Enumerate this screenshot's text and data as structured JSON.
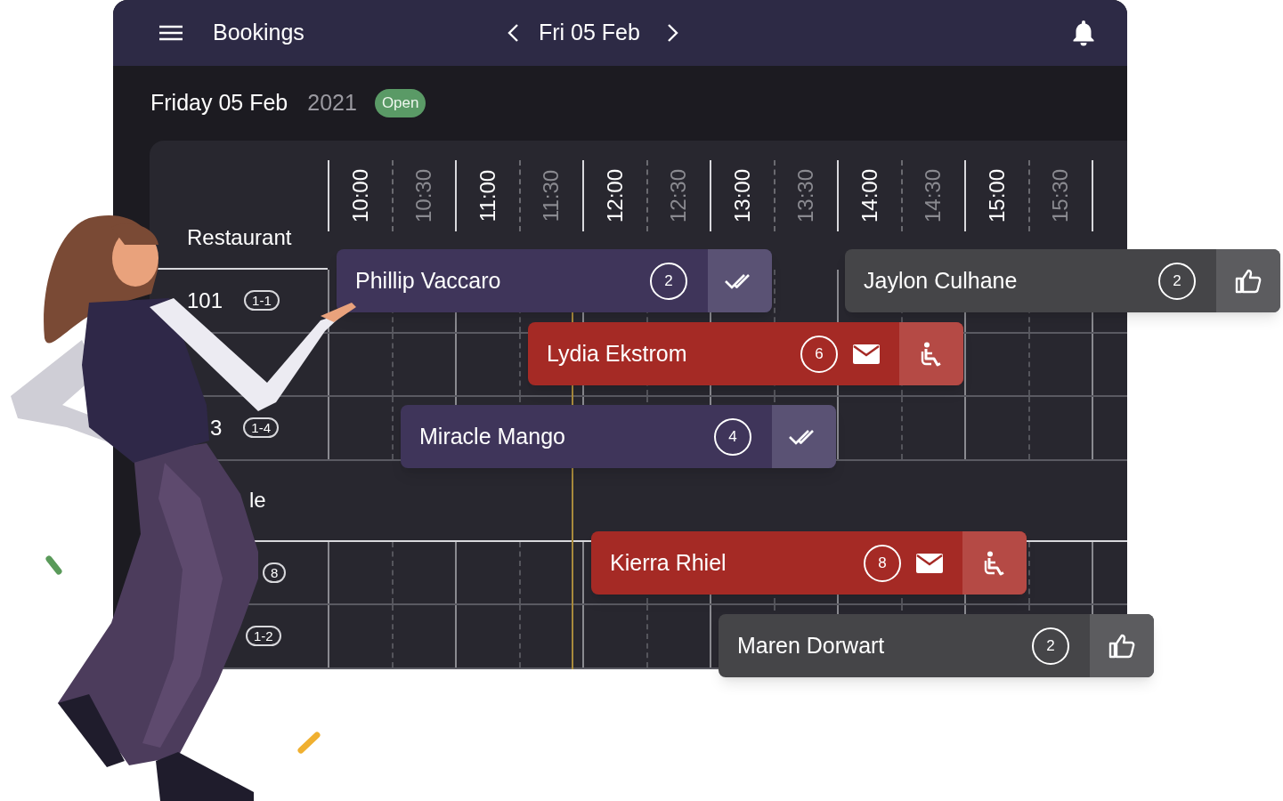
{
  "header": {
    "title": "Bookings",
    "date": "Fri 05 Feb"
  },
  "day": {
    "title": "Friday 05 Feb",
    "year": "2021",
    "status": "Open"
  },
  "times": [
    {
      "label": "10:00",
      "hour": true
    },
    {
      "label": "10:30",
      "hour": false
    },
    {
      "label": "11:00",
      "hour": true
    },
    {
      "label": "11:30",
      "hour": false
    },
    {
      "label": "12:00",
      "hour": true
    },
    {
      "label": "12:30",
      "hour": false
    },
    {
      "label": "13:00",
      "hour": true
    },
    {
      "label": "13:30",
      "hour": false
    },
    {
      "label": "14:00",
      "hour": true
    },
    {
      "label": "14:30",
      "hour": false
    },
    {
      "label": "15:00",
      "hour": true
    },
    {
      "label": "15:30",
      "hour": false
    }
  ],
  "sections": [
    {
      "name": "Restaurant",
      "tables": [
        {
          "number": "101",
          "seats": "1-1"
        },
        {
          "number": "3",
          "seats": "1-4"
        }
      ]
    },
    {
      "name": "le",
      "tables": [
        {
          "seats": "8"
        },
        {
          "seats": "1-2"
        }
      ]
    }
  ],
  "bookings": [
    {
      "name": "Phillip Vaccaro",
      "guests": "2",
      "kind": "seated"
    },
    {
      "name": "Jaylon Culhane",
      "guests": "2",
      "kind": "confirmed"
    },
    {
      "name": "Lydia Ekstrom",
      "guests": "6",
      "kind": "pending"
    },
    {
      "name": "Miracle Mango",
      "guests": "4",
      "kind": "seated"
    },
    {
      "name": "Kierra Rhiel",
      "guests": "8",
      "kind": "pending"
    },
    {
      "name": "Maren Dorwart",
      "guests": "2",
      "kind": "confirmed"
    }
  ]
}
